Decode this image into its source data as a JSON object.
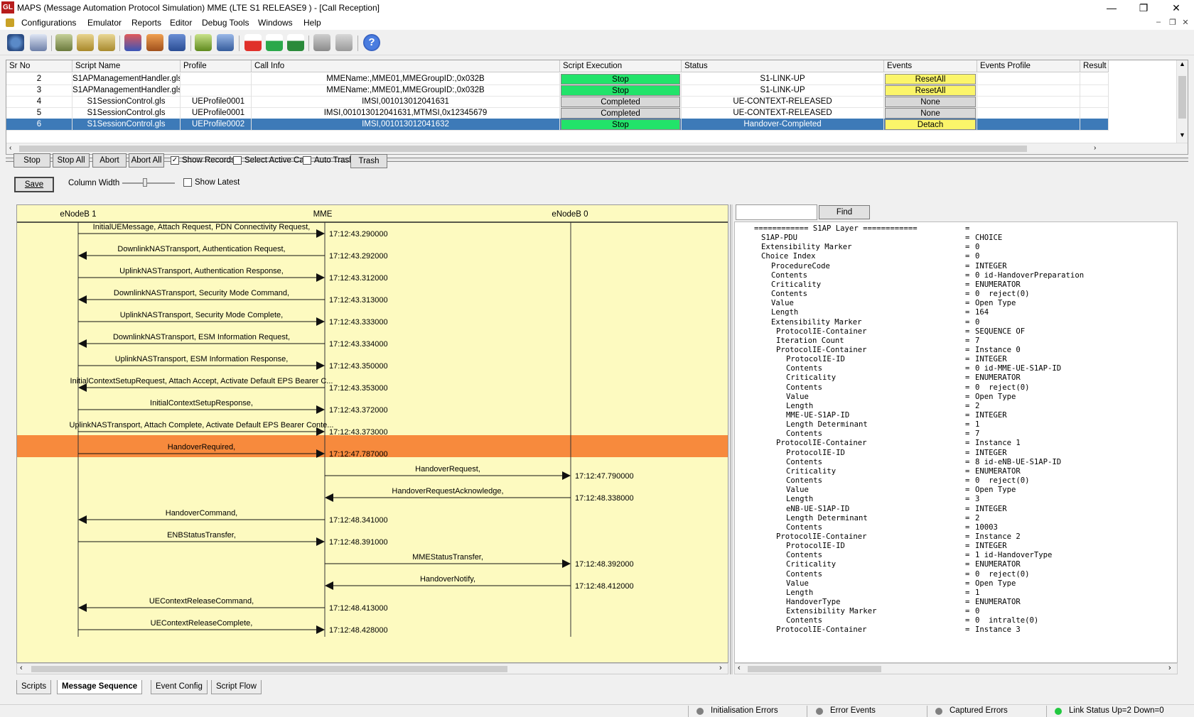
{
  "window": {
    "app_icon": "GL",
    "title": "MAPS (Message Automation Protocol Simulation) MME (LTE S1 RELEASE9 ) - [Call Reception]",
    "controls": [
      "—",
      "❐",
      "✕"
    ]
  },
  "menu": [
    "Configurations",
    "Emulator",
    "Reports",
    "Editor",
    "Debug Tools",
    "Windows",
    "Help"
  ],
  "toolbar_icons": [
    "gear-icon",
    "notes-icon",
    "scripts-icon",
    "profile-icon",
    "load-icon",
    "stop-icon",
    "briefcase-icon",
    "lock-icon",
    "check-icon",
    "settings-icon",
    "record-red-icon",
    "record-green-icon",
    "record-pause-icon",
    "wizard-icon",
    "wizard-grey-icon",
    "help-icon"
  ],
  "grid": {
    "headers": [
      "Sr No",
      "Script Name",
      "Profile",
      "Call Info",
      "Script Execution",
      "Status",
      "Events",
      "Events Profile",
      "Result"
    ],
    "rows": [
      {
        "sr": "2",
        "script": "S1APManagementHandler.gls",
        "profile": "",
        "call_info": "MMEName:,MME01,MMEGroupID:,0x032B",
        "exec": "Stop",
        "exec_kind": "green",
        "status": "S1-LINK-UP",
        "event": "ResetAll",
        "event_kind": "yellow"
      },
      {
        "sr": "3",
        "script": "S1APManagementHandler.gls",
        "profile": "",
        "call_info": "MMEName:,MME01,MMEGroupID:,0x032B",
        "exec": "Stop",
        "exec_kind": "green",
        "status": "S1-LINK-UP",
        "event": "ResetAll",
        "event_kind": "yellow"
      },
      {
        "sr": "4",
        "script": "S1SessionControl.gls",
        "profile": "UEProfile0001",
        "call_info": "IMSI,001013012041631",
        "exec": "Completed",
        "exec_kind": "grey",
        "status": "UE-CONTEXT-RELEASED",
        "event": "None",
        "event_kind": "grey"
      },
      {
        "sr": "5",
        "script": "S1SessionControl.gls",
        "profile": "UEProfile0001",
        "call_info": "IMSI,001013012041631,MTMSI,0x12345679",
        "exec": "Completed",
        "exec_kind": "grey",
        "status": "UE-CONTEXT-RELEASED",
        "event": "None",
        "event_kind": "grey"
      },
      {
        "sr": "6",
        "script": "S1SessionControl.gls",
        "profile": "UEProfile0002",
        "call_info": "IMSI,001013012041632",
        "exec": "Stop",
        "exec_kind": "green",
        "status": "Handover-Completed",
        "event": "Detach",
        "event_kind": "yellow",
        "selected": true
      }
    ]
  },
  "controls": {
    "stop": "Stop",
    "stop_all": "Stop All",
    "abort": "Abort",
    "abort_all": "Abort All",
    "show_records": "Show Records",
    "show_records_checked": true,
    "select_active_call": "Select Active Call",
    "auto_trash": "Auto Trash",
    "trash": "Trash",
    "save": "Save",
    "column_width": "Column Width",
    "show_latest": "Show Latest",
    "find": "Find"
  },
  "sequence": {
    "entities": [
      "eNodeB 1",
      "MME",
      "eNodeB 0"
    ],
    "messages": [
      {
        "label": "InitialUEMessage,  Attach Request,  PDN Connectivity Request,",
        "from": 0,
        "to": 1,
        "time": "17:12:43.290000"
      },
      {
        "label": "DownlinkNASTransport,  Authentication Request,",
        "from": 1,
        "to": 0,
        "time": "17:12:43.292000"
      },
      {
        "label": "UplinkNASTransport,  Authentication Response,",
        "from": 0,
        "to": 1,
        "time": "17:12:43.312000"
      },
      {
        "label": "DownlinkNASTransport,  Security Mode Command,",
        "from": 1,
        "to": 0,
        "time": "17:12:43.313000"
      },
      {
        "label": "UplinkNASTransport,  Security Mode Complete,",
        "from": 0,
        "to": 1,
        "time": "17:12:43.333000"
      },
      {
        "label": "DownlinkNASTransport,  ESM Information Request,",
        "from": 1,
        "to": 0,
        "time": "17:12:43.334000"
      },
      {
        "label": "UplinkNASTransport,  ESM Information Response,",
        "from": 0,
        "to": 1,
        "time": "17:12:43.350000"
      },
      {
        "label": "InitialContextSetupRequest,  Attach Accept,  Activate Default EPS Bearer C...",
        "from": 1,
        "to": 0,
        "time": "17:12:43.353000"
      },
      {
        "label": "InitialContextSetupResponse,",
        "from": 0,
        "to": 1,
        "time": "17:12:43.372000"
      },
      {
        "label": "UplinkNASTransport,  Attach Complete,  Activate Default EPS Bearer Conte...",
        "from": 0,
        "to": 1,
        "time": "17:12:43.373000"
      },
      {
        "label": "HandoverRequired,",
        "from": 0,
        "to": 1,
        "time": "17:12:47.787000",
        "highlight": true
      },
      {
        "label": "HandoverRequest,",
        "from": 1,
        "to": 2,
        "time": "17:12:47.790000"
      },
      {
        "label": "HandoverRequestAcknowledge,",
        "from": 2,
        "to": 1,
        "time": "17:12:48.338000"
      },
      {
        "label": "HandoverCommand,",
        "from": 1,
        "to": 0,
        "time": "17:12:48.341000"
      },
      {
        "label": "ENBStatusTransfer,",
        "from": 0,
        "to": 1,
        "time": "17:12:48.391000"
      },
      {
        "label": "MMEStatusTransfer,",
        "from": 1,
        "to": 2,
        "time": "17:12:48.392000"
      },
      {
        "label": "HandoverNotify,",
        "from": 2,
        "to": 1,
        "time": "17:12:48.412000"
      },
      {
        "label": "UEContextReleaseCommand,",
        "from": 1,
        "to": 0,
        "time": "17:12:48.413000"
      },
      {
        "label": "UEContextReleaseComplete,",
        "from": 0,
        "to": 1,
        "time": "17:12:48.428000"
      }
    ],
    "colors": {
      "background": "#fdfac0",
      "highlight": "#f78a3d"
    }
  },
  "decode": [
    {
      "name": "============ S1AP Layer ============",
      "indent": 0,
      "value": ""
    },
    {
      "name": "S1AP-PDU",
      "indent": 1,
      "value": "CHOICE"
    },
    {
      "name": "Extensibility Marker",
      "indent": 1,
      "value": "0"
    },
    {
      "name": "Choice Index",
      "indent": 1,
      "value": "0"
    },
    {
      "name": "ProcedureCode",
      "indent": 3,
      "value": "INTEGER"
    },
    {
      "name": "Contents",
      "indent": 3,
      "value": "0 id-HandoverPreparation"
    },
    {
      "name": "Criticality",
      "indent": 3,
      "value": "ENUMERATOR"
    },
    {
      "name": "Contents",
      "indent": 3,
      "value": "0  reject(0)"
    },
    {
      "name": "Value",
      "indent": 3,
      "value": "Open Type"
    },
    {
      "name": "Length",
      "indent": 3,
      "value": "164"
    },
    {
      "name": "Extensibility Marker",
      "indent": 3,
      "value": "0"
    },
    {
      "name": "ProtocolIE-Container",
      "indent": 4,
      "value": "SEQUENCE OF"
    },
    {
      "name": "Iteration Count",
      "indent": 4,
      "value": "7"
    },
    {
      "name": "ProtocolIE-Container",
      "indent": 4,
      "value": "Instance 0"
    },
    {
      "name": "ProtocolIE-ID",
      "indent": 6,
      "value": "INTEGER"
    },
    {
      "name": "Contents",
      "indent": 6,
      "value": "0 id-MME-UE-S1AP-ID"
    },
    {
      "name": "Criticality",
      "indent": 6,
      "value": "ENUMERATOR"
    },
    {
      "name": "Contents",
      "indent": 6,
      "value": "0  reject(0)"
    },
    {
      "name": "Value",
      "indent": 6,
      "value": "Open Type"
    },
    {
      "name": "Length",
      "indent": 6,
      "value": "2"
    },
    {
      "name": "MME-UE-S1AP-ID",
      "indent": 6,
      "value": "INTEGER"
    },
    {
      "name": "Length Determinant",
      "indent": 6,
      "value": "1"
    },
    {
      "name": "Contents",
      "indent": 6,
      "value": "7"
    },
    {
      "name": "ProtocolIE-Container",
      "indent": 4,
      "value": "Instance 1"
    },
    {
      "name": "ProtocolIE-ID",
      "indent": 6,
      "value": "INTEGER"
    },
    {
      "name": "Contents",
      "indent": 6,
      "value": "8 id-eNB-UE-S1AP-ID"
    },
    {
      "name": "Criticality",
      "indent": 6,
      "value": "ENUMERATOR"
    },
    {
      "name": "Contents",
      "indent": 6,
      "value": "0  reject(0)"
    },
    {
      "name": "Value",
      "indent": 6,
      "value": "Open Type"
    },
    {
      "name": "Length",
      "indent": 6,
      "value": "3"
    },
    {
      "name": "eNB-UE-S1AP-ID",
      "indent": 6,
      "value": "INTEGER"
    },
    {
      "name": "Length Determinant",
      "indent": 6,
      "value": "2"
    },
    {
      "name": "Contents",
      "indent": 6,
      "value": "10003"
    },
    {
      "name": "ProtocolIE-Container",
      "indent": 4,
      "value": "Instance 2"
    },
    {
      "name": "ProtocolIE-ID",
      "indent": 6,
      "value": "INTEGER"
    },
    {
      "name": "Contents",
      "indent": 6,
      "value": "1 id-HandoverType"
    },
    {
      "name": "Criticality",
      "indent": 6,
      "value": "ENUMERATOR"
    },
    {
      "name": "Contents",
      "indent": 6,
      "value": "0  reject(0)"
    },
    {
      "name": "Value",
      "indent": 6,
      "value": "Open Type"
    },
    {
      "name": "Length",
      "indent": 6,
      "value": "1"
    },
    {
      "name": "HandoverType",
      "indent": 6,
      "value": "ENUMERATOR"
    },
    {
      "name": "Extensibility Marker",
      "indent": 6,
      "value": "0"
    },
    {
      "name": "Contents",
      "indent": 6,
      "value": "0  intralte(0)"
    },
    {
      "name": "ProtocolIE-Container",
      "indent": 4,
      "value": "Instance 3"
    }
  ],
  "tabs": [
    {
      "label": "Scripts",
      "active": false
    },
    {
      "label": "Message Sequence",
      "active": true
    },
    {
      "label": "Event Config",
      "active": false
    },
    {
      "label": "Script Flow",
      "active": false
    }
  ],
  "status_bar": [
    {
      "label": "Initialisation Errors",
      "color": "#808080"
    },
    {
      "label": "Error Events",
      "color": "#808080"
    },
    {
      "label": "Captured Errors",
      "color": "#808080"
    },
    {
      "label": "Link Status Up=2 Down=0",
      "color": "#22c840"
    }
  ]
}
